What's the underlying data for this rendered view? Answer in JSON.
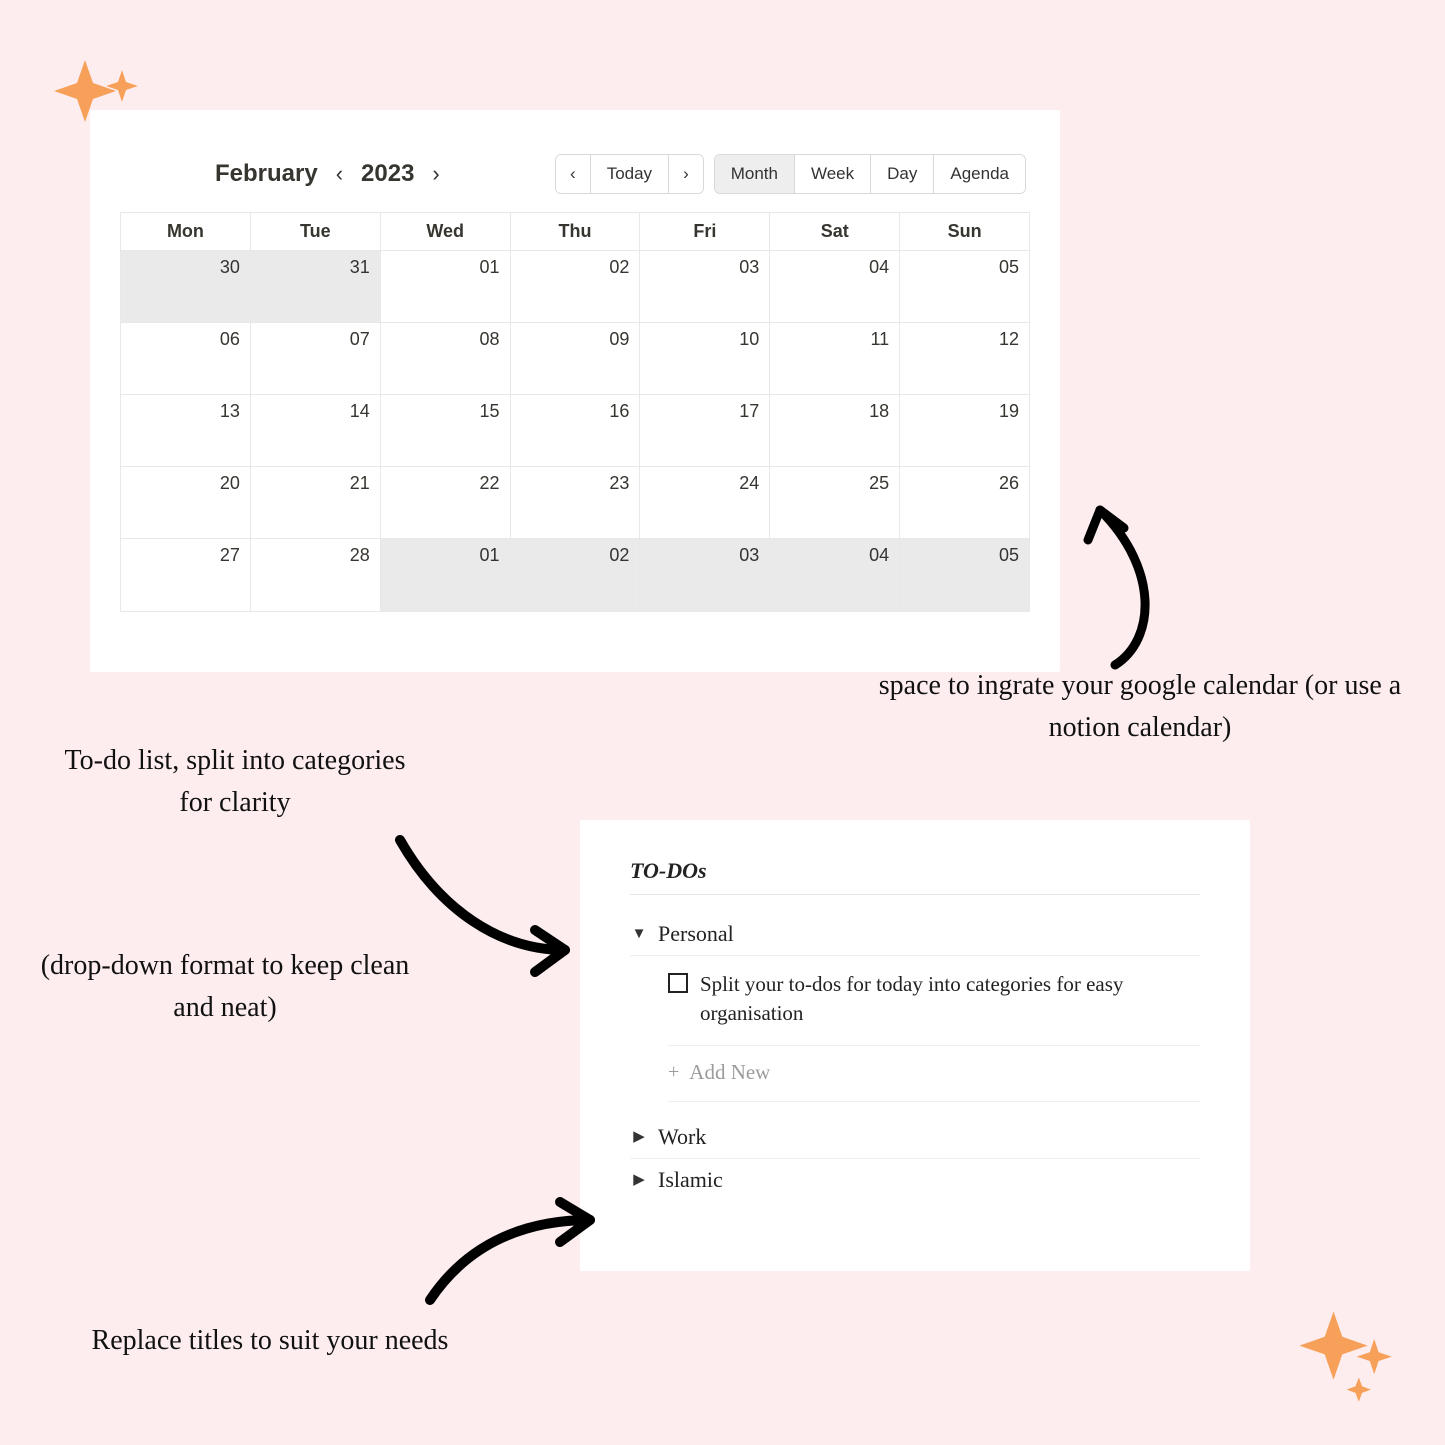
{
  "calendar": {
    "month": "February",
    "year": "2023",
    "today_label": "Today",
    "views": [
      "Month",
      "Week",
      "Day",
      "Agenda"
    ],
    "active_view": "Month",
    "weekdays": [
      "Mon",
      "Tue",
      "Wed",
      "Thu",
      "Fri",
      "Sat",
      "Sun"
    ],
    "weeks": [
      [
        {
          "n": "30",
          "dim": true
        },
        {
          "n": "31",
          "dim": true
        },
        {
          "n": "01",
          "dim": false
        },
        {
          "n": "02",
          "dim": false
        },
        {
          "n": "03",
          "dim": false
        },
        {
          "n": "04",
          "dim": false
        },
        {
          "n": "05",
          "dim": false
        }
      ],
      [
        {
          "n": "06",
          "dim": false
        },
        {
          "n": "07",
          "dim": false
        },
        {
          "n": "08",
          "dim": false
        },
        {
          "n": "09",
          "dim": false
        },
        {
          "n": "10",
          "dim": false
        },
        {
          "n": "11",
          "dim": false
        },
        {
          "n": "12",
          "dim": false
        }
      ],
      [
        {
          "n": "13",
          "dim": false
        },
        {
          "n": "14",
          "dim": false
        },
        {
          "n": "15",
          "dim": false
        },
        {
          "n": "16",
          "dim": false
        },
        {
          "n": "17",
          "dim": false
        },
        {
          "n": "18",
          "dim": false
        },
        {
          "n": "19",
          "dim": false
        }
      ],
      [
        {
          "n": "20",
          "dim": false
        },
        {
          "n": "21",
          "dim": false
        },
        {
          "n": "22",
          "dim": false
        },
        {
          "n": "23",
          "dim": false
        },
        {
          "n": "24",
          "dim": false
        },
        {
          "n": "25",
          "dim": false
        },
        {
          "n": "26",
          "dim": false
        }
      ],
      [
        {
          "n": "27",
          "dim": false
        },
        {
          "n": "28",
          "dim": false
        },
        {
          "n": "01",
          "dim": true
        },
        {
          "n": "02",
          "dim": true
        },
        {
          "n": "03",
          "dim": true
        },
        {
          "n": "04",
          "dim": true
        },
        {
          "n": "05",
          "dim": true
        }
      ]
    ]
  },
  "annotations": {
    "calendar_note": "space to ingrate your google calendar (or use a notion calendar)",
    "todo_note": "To-do list, split into categories for clarity",
    "dropdown_note": "(drop-down format to keep clean and neat)",
    "titles_note": "Replace titles to suit your needs"
  },
  "todos": {
    "title": "TO-DOs",
    "sections": [
      {
        "name": "Personal",
        "open": true,
        "items": [
          "Split your to-dos for today into categories for easy organisation"
        ]
      },
      {
        "name": "Work",
        "open": false,
        "items": []
      },
      {
        "name": "Islamic",
        "open": false,
        "items": []
      }
    ],
    "add_new_label": "Add New"
  }
}
